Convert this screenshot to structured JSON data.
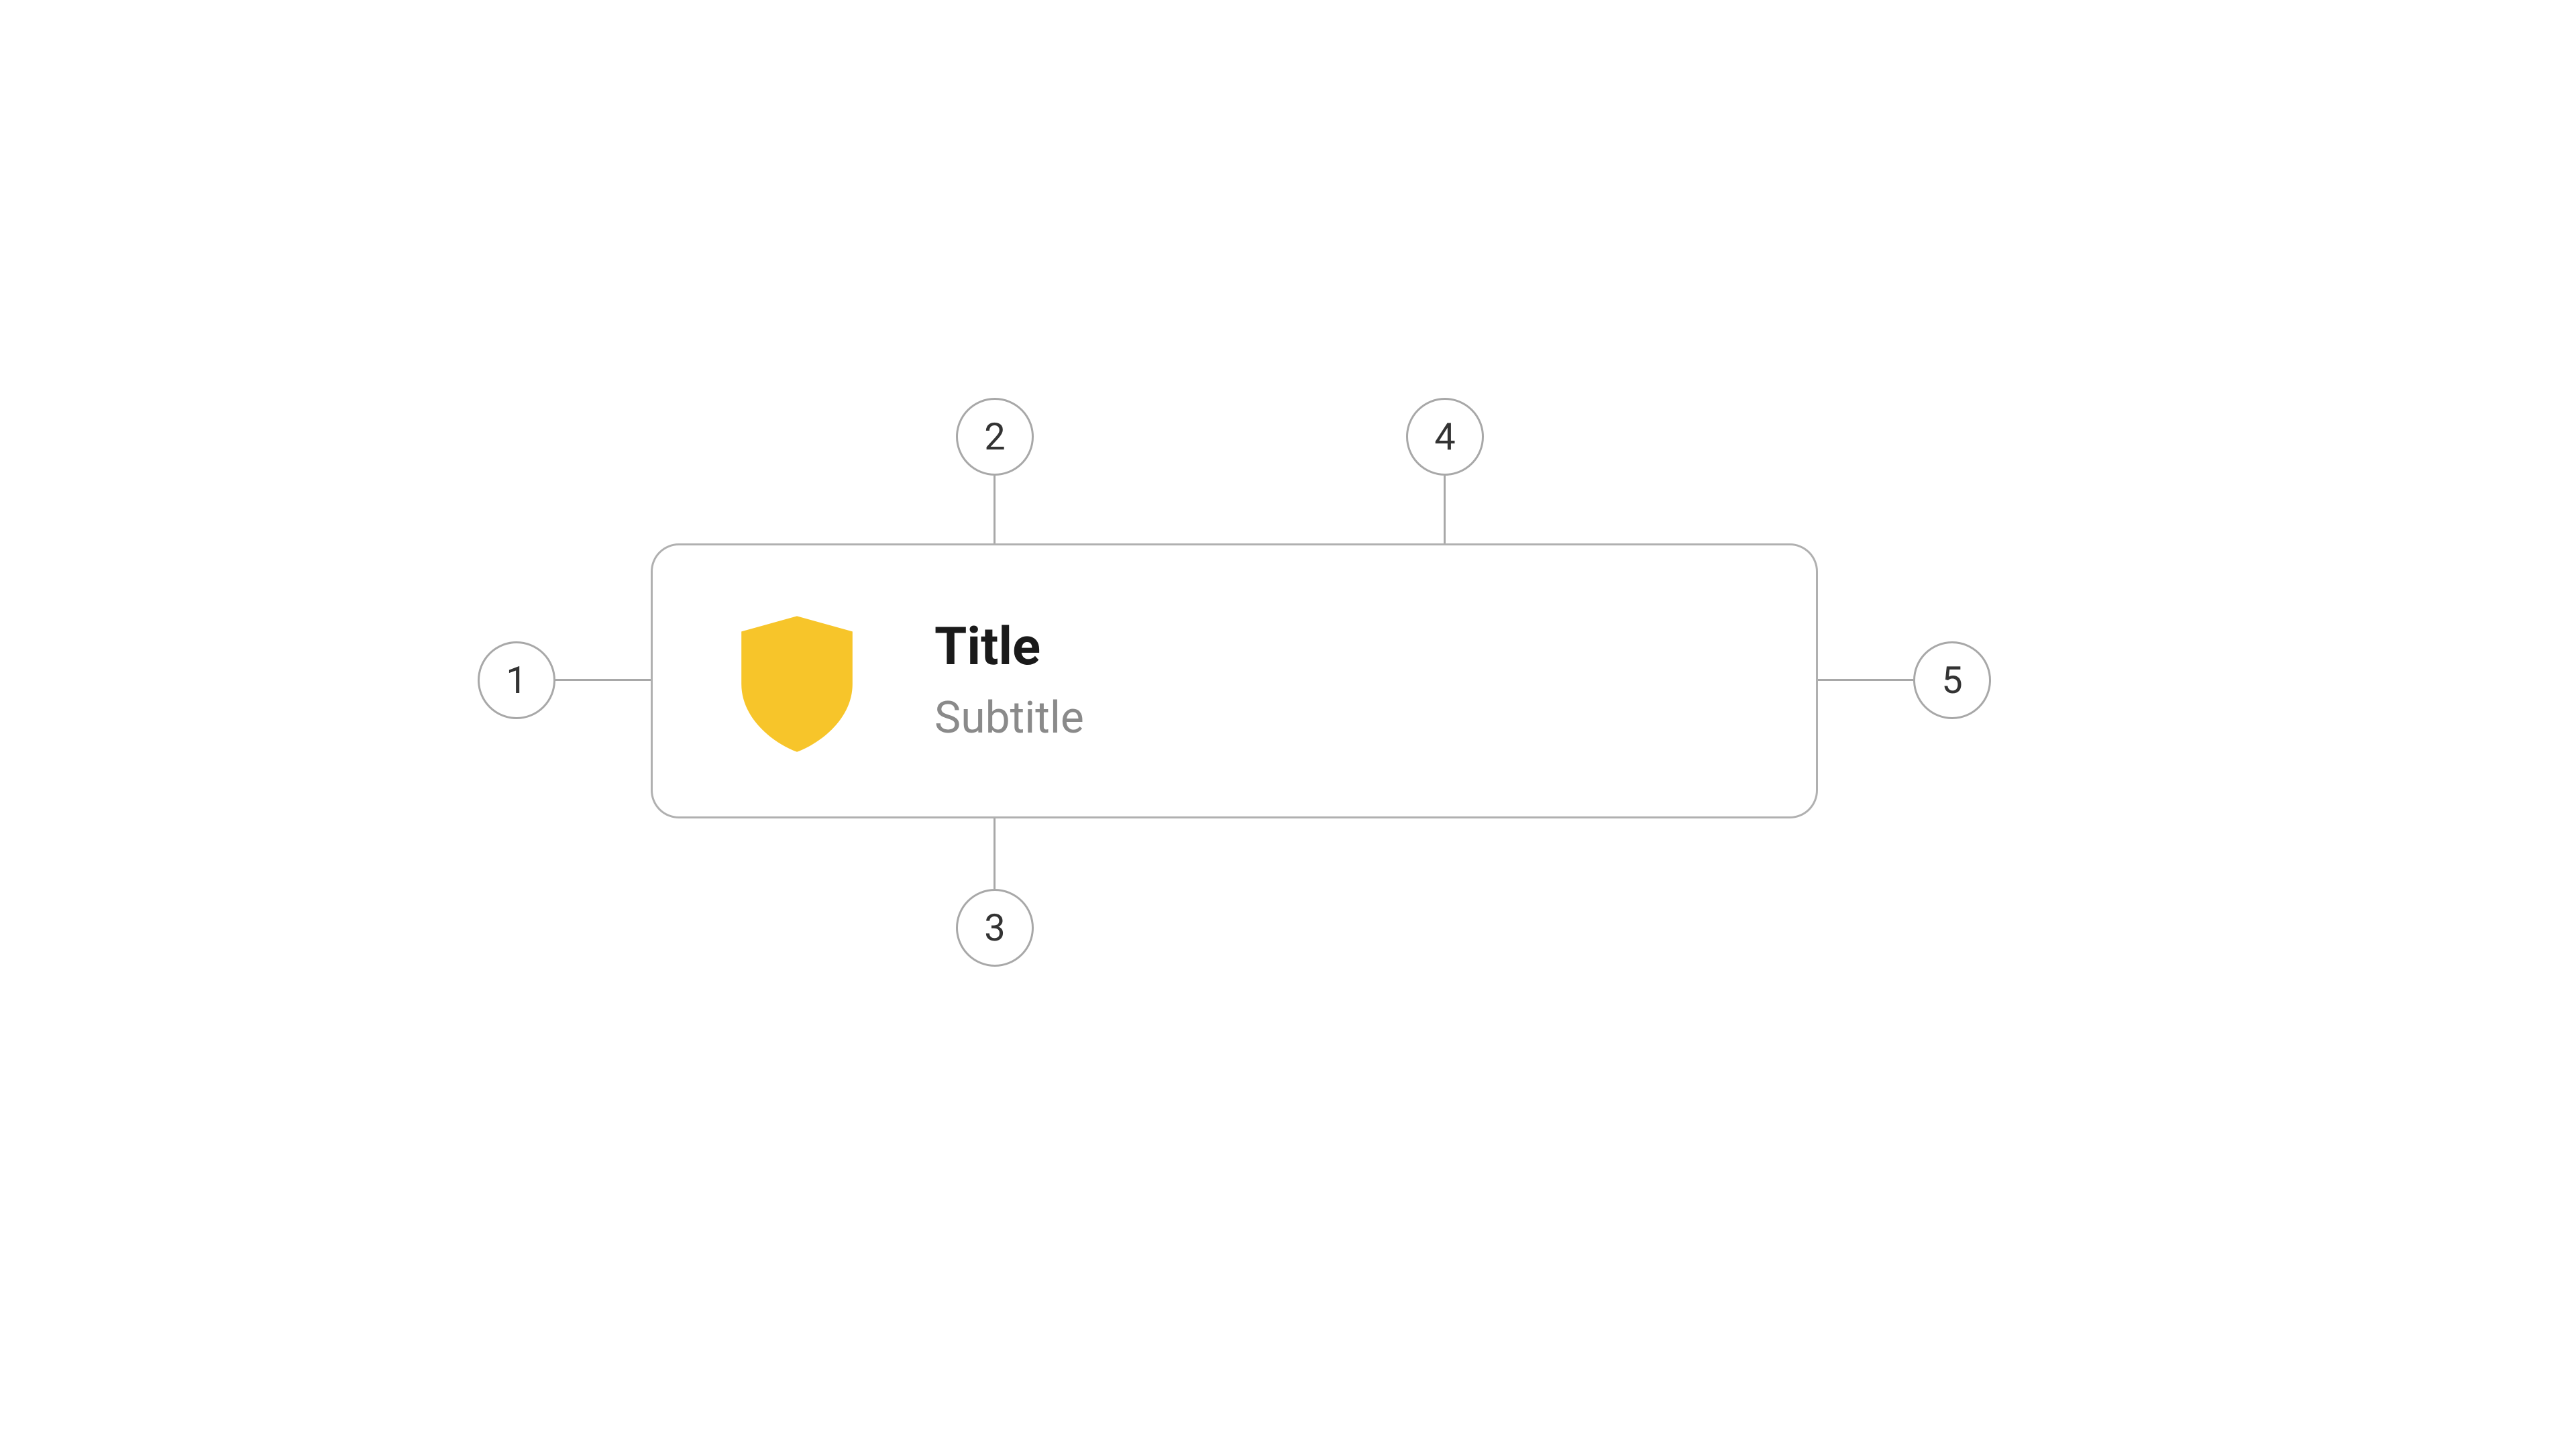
{
  "card": {
    "title": "Title",
    "subtitle": "Subtitle",
    "icon_name": "shield-icon",
    "icon_color": "#F7C52A"
  },
  "callouts": [
    {
      "number": "1",
      "target": "leading-icon"
    },
    {
      "number": "2",
      "target": "title"
    },
    {
      "number": "3",
      "target": "subtitle"
    },
    {
      "number": "4",
      "target": "trailing-area"
    },
    {
      "number": "5",
      "target": "card-right"
    }
  ],
  "colors": {
    "border": "#B0B0B0",
    "title_text": "#1a1a1a",
    "subtitle_text": "#8a8a8a",
    "callout_border": "#A8A8A8",
    "icon_fill": "#F7C52A",
    "background": "#ffffff"
  }
}
